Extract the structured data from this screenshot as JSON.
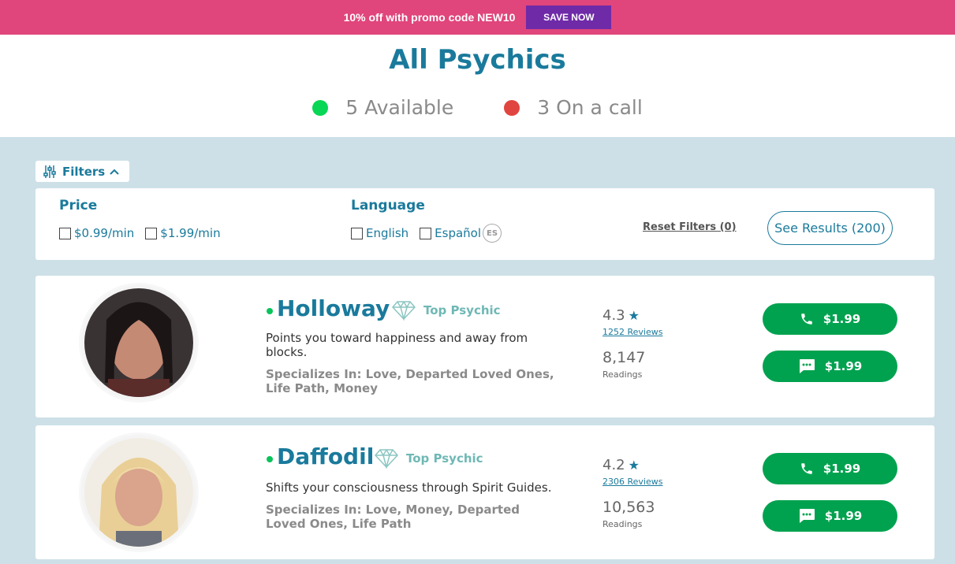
{
  "promo": {
    "text": "10% off with promo code NEW10",
    "button": "SAVE NOW"
  },
  "header": {
    "title": "All Psychics",
    "available": "5 Available",
    "on_call": "3 On a call"
  },
  "filters": {
    "toggle_label": "Filters",
    "price": {
      "title": "Price",
      "options": [
        "$0.99/min",
        "$1.99/min"
      ]
    },
    "language": {
      "title": "Language",
      "options": [
        "English",
        "Español"
      ],
      "es_badge": "ES"
    },
    "reset": "Reset Filters (0)",
    "see_results": "See Results (200)"
  },
  "psychics": [
    {
      "name": "Holloway",
      "badge": "Top Psychic",
      "tagline": "Points you toward happiness and away from blocks.",
      "specialties": "Specializes In: Love, Departed Loved Ones, Life Path, Money",
      "rating": "4.3",
      "reviews": "1252 Reviews",
      "readings": "8,147",
      "readings_label": "Readings",
      "call_price": "$1.99",
      "chat_price": "$1.99"
    },
    {
      "name": "Daffodil",
      "badge": "Top Psychic",
      "tagline": "Shifts your consciousness through Spirit Guides.",
      "specialties": "Specializes In: Love, Money, Departed Loved Ones, Life Path",
      "rating": "4.2",
      "reviews": "2306 Reviews",
      "readings": "10,563",
      "readings_label": "Readings",
      "call_price": "$1.99",
      "chat_price": "$1.99"
    }
  ],
  "icons": {
    "filters": "sliders-icon",
    "chevron": "chevron-up-icon",
    "badge": "diamond-icon",
    "star": "star-icon",
    "call": "phone-icon",
    "chat": "chat-icon"
  },
  "colors": {
    "promo": "#e0457b",
    "promo_button": "#6f2aa8",
    "brand": "#1a7a9c",
    "action": "#01a24f",
    "available": "#08d655",
    "busy": "#e0453f",
    "background": "#cde0e7"
  }
}
